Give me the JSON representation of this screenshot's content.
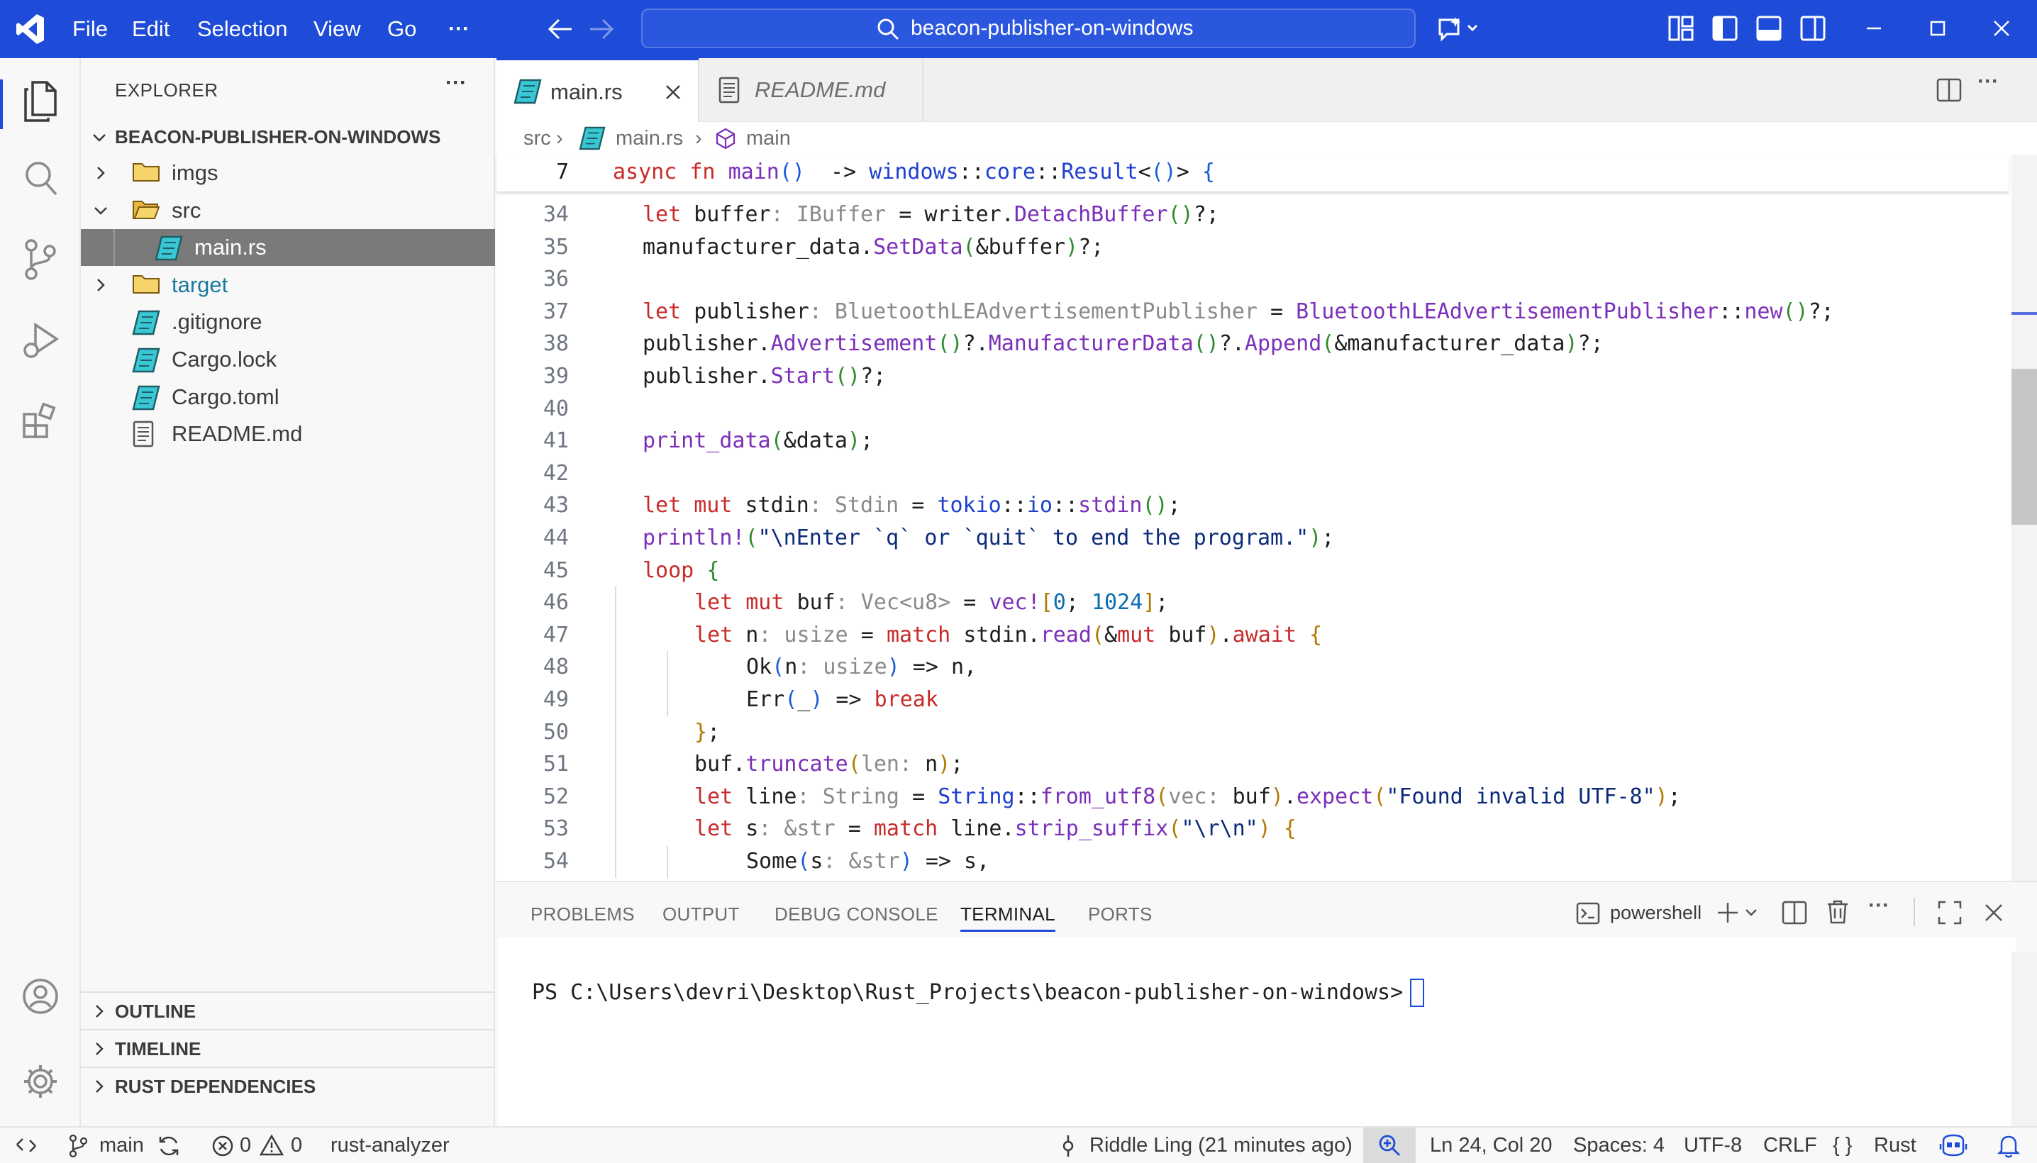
{
  "titlebar": {
    "menu": [
      "File",
      "Edit",
      "Selection",
      "View",
      "Go"
    ],
    "more": "···",
    "search": "beacon-publisher-on-windows"
  },
  "explorer": {
    "title": "EXPLORER",
    "more": "···",
    "root": "BEACON-PUBLISHER-ON-WINDOWS",
    "items": [
      {
        "label": "imgs",
        "kind": "folder",
        "depth": 1,
        "open": false
      },
      {
        "label": "src",
        "kind": "folder",
        "depth": 1,
        "open": true
      },
      {
        "label": "main.rs",
        "kind": "rust",
        "depth": 2,
        "selected": true
      },
      {
        "label": "target",
        "kind": "folder",
        "depth": 1,
        "open": false,
        "color": "#1b7a9e"
      },
      {
        "label": ".gitignore",
        "kind": "rust",
        "depth": 1
      },
      {
        "label": "Cargo.lock",
        "kind": "rust",
        "depth": 1
      },
      {
        "label": "Cargo.toml",
        "kind": "rust",
        "depth": 1
      },
      {
        "label": "README.md",
        "kind": "doc",
        "depth": 1
      }
    ],
    "sections": [
      "OUTLINE",
      "TIMELINE",
      "RUST DEPENDENCIES"
    ]
  },
  "tabs": [
    {
      "label": "main.rs",
      "active": true
    },
    {
      "label": "README.md",
      "active": false
    }
  ],
  "breadcrumb": {
    "folder": "src",
    "file": "main.rs",
    "symbol": "main"
  },
  "sticky": {
    "num": "7",
    "code": [
      [
        "kw",
        "async "
      ],
      [
        "kw",
        "fn "
      ],
      [
        "fn",
        "main"
      ],
      [
        "p1",
        "()"
      ],
      [
        "",
        "  -> "
      ],
      [
        "ns",
        "windows"
      ],
      [
        "",
        "::"
      ],
      [
        "ns",
        "core"
      ],
      [
        "",
        "::"
      ],
      [
        "ns",
        "Result"
      ],
      [
        "",
        "<"
      ],
      [
        "p1",
        "()"
      ],
      [
        "",
        "> "
      ],
      [
        "p1",
        "{"
      ]
    ]
  },
  "code_lines": [
    {
      "num": "34",
      "indent": 1,
      "code": [
        [
          "kw",
          "let "
        ],
        [
          "",
          "buffer"
        ],
        [
          "ty",
          ": IBuffer"
        ],
        [
          "",
          " = writer."
        ],
        [
          "fn",
          "DetachBuffer"
        ],
        [
          "p2",
          "()"
        ],
        [
          "",
          "?;"
        ]
      ]
    },
    {
      "num": "35",
      "indent": 1,
      "code": [
        [
          "",
          "manufacturer_data."
        ],
        [
          "fn",
          "SetData"
        ],
        [
          "p2",
          "("
        ],
        [
          "",
          "&buffer"
        ],
        [
          "p2",
          ")"
        ],
        [
          "",
          "?;"
        ]
      ]
    },
    {
      "num": "36",
      "indent": 0,
      "code": []
    },
    {
      "num": "37",
      "indent": 1,
      "code": [
        [
          "kw",
          "let "
        ],
        [
          "",
          "publisher"
        ],
        [
          "ty",
          ": BluetoothLEAdvertisementPublisher"
        ],
        [
          "",
          " = "
        ],
        [
          "fn",
          "BluetoothLEAdvertisementPublisher"
        ],
        [
          "",
          "::"
        ],
        [
          "fn",
          "new"
        ],
        [
          "p2",
          "()"
        ],
        [
          "",
          "?;"
        ]
      ]
    },
    {
      "num": "38",
      "indent": 1,
      "code": [
        [
          "",
          "publisher."
        ],
        [
          "fn",
          "Advertisement"
        ],
        [
          "p2",
          "()"
        ],
        [
          "",
          "?."
        ],
        [
          "fn",
          "ManufacturerData"
        ],
        [
          "p2",
          "()"
        ],
        [
          "",
          "?."
        ],
        [
          "fn",
          "Append"
        ],
        [
          "p2",
          "("
        ],
        [
          "",
          "&manufacturer_data"
        ],
        [
          "p2",
          ")"
        ],
        [
          "",
          "?;"
        ]
      ]
    },
    {
      "num": "39",
      "indent": 1,
      "code": [
        [
          "",
          "publisher."
        ],
        [
          "fn",
          "Start"
        ],
        [
          "p2",
          "()"
        ],
        [
          "",
          "?;"
        ]
      ]
    },
    {
      "num": "40",
      "indent": 0,
      "code": []
    },
    {
      "num": "41",
      "indent": 1,
      "code": [
        [
          "fn",
          "print_data"
        ],
        [
          "p2",
          "("
        ],
        [
          "",
          "&data"
        ],
        [
          "p2",
          ")"
        ],
        [
          "",
          ";"
        ]
      ]
    },
    {
      "num": "42",
      "indent": 0,
      "code": []
    },
    {
      "num": "43",
      "indent": 1,
      "code": [
        [
          "kw",
          "let mut "
        ],
        [
          "",
          "stdin"
        ],
        [
          "ty",
          ": Stdin"
        ],
        [
          "",
          " = "
        ],
        [
          "ns",
          "tokio"
        ],
        [
          "",
          "::"
        ],
        [
          "ns",
          "io"
        ],
        [
          "",
          "::"
        ],
        [
          "fn",
          "stdin"
        ],
        [
          "p2",
          "()"
        ],
        [
          "",
          ";"
        ]
      ]
    },
    {
      "num": "44",
      "indent": 1,
      "code": [
        [
          "fn",
          "println!"
        ],
        [
          "p2",
          "("
        ],
        [
          "st",
          "\"\\nEnter `q` or `quit` to end the program.\""
        ],
        [
          "p2",
          ")"
        ],
        [
          "",
          ";"
        ]
      ]
    },
    {
      "num": "45",
      "indent": 1,
      "code": [
        [
          "kw",
          "loop "
        ],
        [
          "p2",
          "{"
        ]
      ]
    },
    {
      "num": "46",
      "indent": 2,
      "code": [
        [
          "kw",
          "let mut "
        ],
        [
          "",
          "buf"
        ],
        [
          "ty",
          ": Vec<u8>"
        ],
        [
          "",
          " = "
        ],
        [
          "fn",
          "vec!"
        ],
        [
          "p3",
          "["
        ],
        [
          "nm",
          "0"
        ],
        [
          "",
          "; "
        ],
        [
          "nm",
          "1024"
        ],
        [
          "p3",
          "]"
        ],
        [
          "",
          ";"
        ]
      ]
    },
    {
      "num": "47",
      "indent": 2,
      "code": [
        [
          "kw",
          "let "
        ],
        [
          "",
          "n"
        ],
        [
          "ty",
          ": usize"
        ],
        [
          "",
          " = "
        ],
        [
          "kw",
          "match "
        ],
        [
          "",
          "stdin."
        ],
        [
          "fn",
          "read"
        ],
        [
          "p3",
          "("
        ],
        [
          "",
          "&"
        ],
        [
          "kw",
          "mut "
        ],
        [
          "",
          "buf"
        ],
        [
          "p3",
          ")"
        ],
        [
          "",
          "."
        ],
        [
          "kw",
          "await "
        ],
        [
          "p3",
          "{"
        ]
      ]
    },
    {
      "num": "48",
      "indent": 3,
      "code": [
        [
          "",
          "Ok"
        ],
        [
          "p1",
          "("
        ],
        [
          "",
          "n"
        ],
        [
          "ty",
          ": usize"
        ],
        [
          "p1",
          ")"
        ],
        [
          "",
          " => n,"
        ]
      ]
    },
    {
      "num": "49",
      "indent": 3,
      "code": [
        [
          "",
          "Err"
        ],
        [
          "p1",
          "("
        ],
        [
          "",
          "_"
        ],
        [
          "p1",
          ")"
        ],
        [
          "",
          " => "
        ],
        [
          "kw",
          "break"
        ]
      ]
    },
    {
      "num": "50",
      "indent": 2,
      "code": [
        [
          "p3",
          "}"
        ],
        [
          "",
          ";"
        ]
      ]
    },
    {
      "num": "51",
      "indent": 2,
      "code": [
        [
          "",
          "buf."
        ],
        [
          "fn",
          "truncate"
        ],
        [
          "p3",
          "("
        ],
        [
          "ty",
          "len: "
        ],
        [
          "",
          "n"
        ],
        [
          "p3",
          ")"
        ],
        [
          "",
          ";"
        ]
      ]
    },
    {
      "num": "52",
      "indent": 2,
      "code": [
        [
          "kw",
          "let "
        ],
        [
          "",
          "line"
        ],
        [
          "ty",
          ": String"
        ],
        [
          "",
          " = "
        ],
        [
          "ns",
          "String"
        ],
        [
          "",
          "::"
        ],
        [
          "fn",
          "from_utf8"
        ],
        [
          "p3",
          "("
        ],
        [
          "ty",
          "vec: "
        ],
        [
          "",
          "buf"
        ],
        [
          "p3",
          ")"
        ],
        [
          "",
          "."
        ],
        [
          "fn",
          "expect"
        ],
        [
          "p3",
          "("
        ],
        [
          "st",
          "\"Found invalid UTF-8\""
        ],
        [
          "p3",
          ")"
        ],
        [
          "",
          ";"
        ]
      ]
    },
    {
      "num": "53",
      "indent": 2,
      "code": [
        [
          "kw",
          "let "
        ],
        [
          "",
          "s"
        ],
        [
          "ty",
          ": &str"
        ],
        [
          "",
          " = "
        ],
        [
          "kw",
          "match "
        ],
        [
          "",
          "line."
        ],
        [
          "fn",
          "strip_suffix"
        ],
        [
          "p3",
          "("
        ],
        [
          "st",
          "\"\\r\\n\""
        ],
        [
          "p3",
          ") {"
        ]
      ]
    },
    {
      "num": "54",
      "indent": 3,
      "code": [
        [
          "",
          "Some"
        ],
        [
          "p1",
          "("
        ],
        [
          "",
          "s"
        ],
        [
          "ty",
          ": &str"
        ],
        [
          "p1",
          ")"
        ],
        [
          "",
          " => s,"
        ]
      ]
    }
  ],
  "panel": {
    "tabs": [
      "PROBLEMS",
      "OUTPUT",
      "DEBUG CONSOLE",
      "TERMINAL",
      "PORTS"
    ],
    "active_tab": "TERMINAL",
    "shell": "powershell",
    "more": "···",
    "prompt": "PS C:\\Users\\devri\\Desktop\\Rust_Projects\\beacon-publisher-on-windows>"
  },
  "statusbar": {
    "branch": "main",
    "errors": "0",
    "warnings": "0",
    "analyzer": "rust-analyzer",
    "blame": "Riddle Ling (21 minutes ago)",
    "position": "Ln 24, Col 20",
    "spaces": "Spaces: 4",
    "encoding": "UTF-8",
    "eol": "CRLF",
    "language": "Rust",
    "lang_prefix": "{ }"
  },
  "colors": {
    "titlebar": "#1e4bd8",
    "accent": "#1e4bd8",
    "selection": "#7a7a7a",
    "rust_icon": "#3ac7d4"
  }
}
